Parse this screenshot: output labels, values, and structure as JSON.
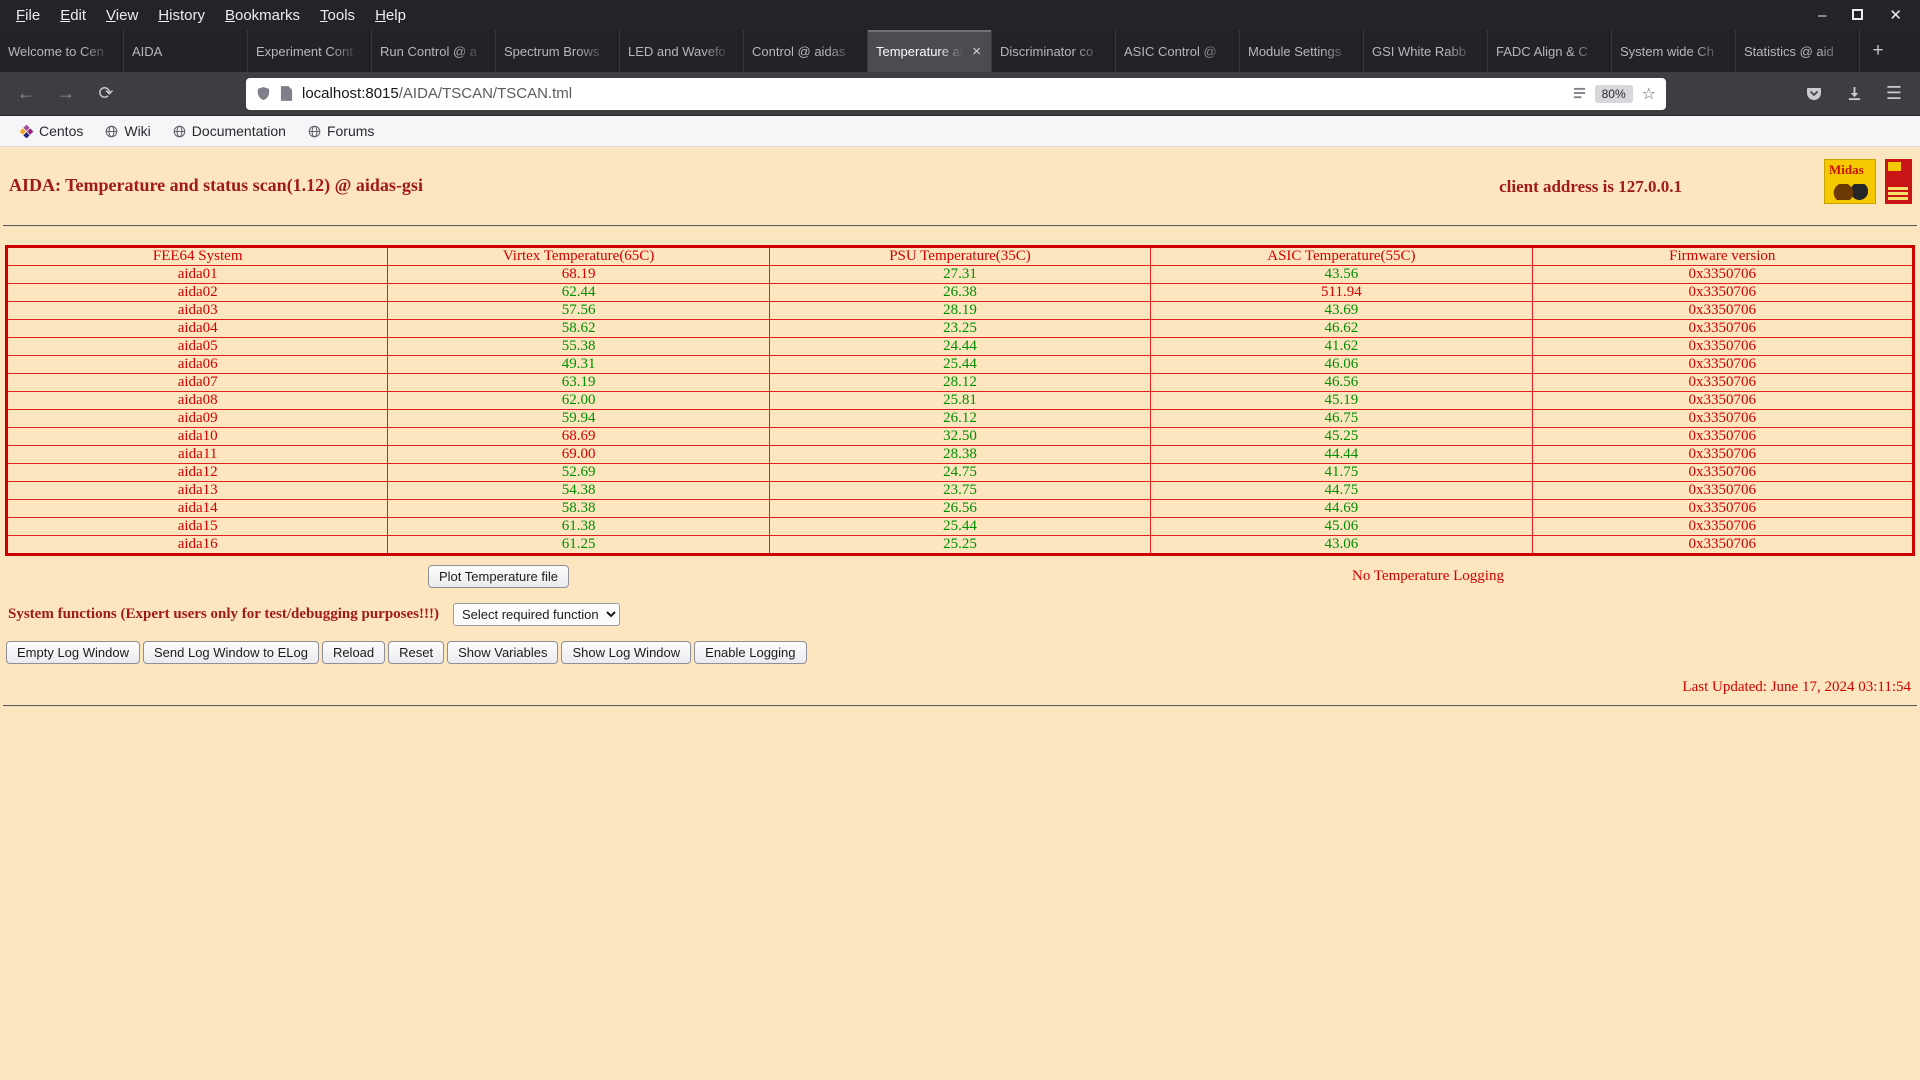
{
  "colors": {
    "page_background": "#fce6c0",
    "title_maroon": "#a01a1a",
    "alert_red": "#d40000",
    "value_green": "#008f00",
    "table_border_red": "#cc0000"
  },
  "window": {
    "menu_items": [
      "File",
      "Edit",
      "View",
      "History",
      "Bookmarks",
      "Tools",
      "Help"
    ],
    "controls": {
      "minimize": "–",
      "close": "✕"
    }
  },
  "tabs": [
    {
      "label": "Welcome to Cen"
    },
    {
      "label": "AIDA"
    },
    {
      "label": "Experiment Cont"
    },
    {
      "label": "Run Control @ a"
    },
    {
      "label": "Spectrum Brows"
    },
    {
      "label": "LED and Wavefo"
    },
    {
      "label": "Control @ aidas"
    },
    {
      "label": "Temperature an",
      "active": true
    },
    {
      "label": "Discriminator co"
    },
    {
      "label": "ASIC Control @"
    },
    {
      "label": "Module Settings"
    },
    {
      "label": "GSI White Rabb"
    },
    {
      "label": "FADC Align & C"
    },
    {
      "label": "System wide Ch"
    },
    {
      "label": "Statistics @ aid"
    }
  ],
  "icons": {
    "new_tab": "+",
    "close_tab": "×",
    "back": "←",
    "forward": "→",
    "reload": "⟳",
    "star": "☆",
    "menu": "☰"
  },
  "navbar": {
    "url_host": "localhost:8015",
    "url_path": "/AIDA/TSCAN/TSCAN.tml",
    "zoom_badge": "80%"
  },
  "bookmarks": [
    "Centos",
    "Wiki",
    "Documentation",
    "Forums"
  ],
  "page": {
    "title": "AIDA: Temperature and status scan(1.12) @ aidas-gsi",
    "client_address": "client address is 127.0.0.1",
    "logo_text": "Midas",
    "table": {
      "headers": [
        "FEE64 System",
        "Virtex Temperature(65C)",
        "PSU Temperature(35C)",
        "ASIC Temperature(55C)",
        "Firmware version"
      ],
      "thresholds": {
        "virtex": 65,
        "psu": 35,
        "asic": 55
      },
      "rows": [
        {
          "name": "aida01",
          "virtex": "68.19",
          "psu": "27.31",
          "asic": "43.56",
          "firmware": "0x3350706"
        },
        {
          "name": "aida02",
          "virtex": "62.44",
          "psu": "26.38",
          "asic": "511.94",
          "firmware": "0x3350706"
        },
        {
          "name": "aida03",
          "virtex": "57.56",
          "psu": "28.19",
          "asic": "43.69",
          "firmware": "0x3350706"
        },
        {
          "name": "aida04",
          "virtex": "58.62",
          "psu": "23.25",
          "asic": "46.62",
          "firmware": "0x3350706"
        },
        {
          "name": "aida05",
          "virtex": "55.38",
          "psu": "24.44",
          "asic": "41.62",
          "firmware": "0x3350706"
        },
        {
          "name": "aida06",
          "virtex": "49.31",
          "psu": "25.44",
          "asic": "46.06",
          "firmware": "0x3350706"
        },
        {
          "name": "aida07",
          "virtex": "63.19",
          "psu": "28.12",
          "asic": "46.56",
          "firmware": "0x3350706"
        },
        {
          "name": "aida08",
          "virtex": "62.00",
          "psu": "25.81",
          "asic": "45.19",
          "firmware": "0x3350706"
        },
        {
          "name": "aida09",
          "virtex": "59.94",
          "psu": "26.12",
          "asic": "46.75",
          "firmware": "0x3350706"
        },
        {
          "name": "aida10",
          "virtex": "68.69",
          "psu": "32.50",
          "asic": "45.25",
          "firmware": "0x3350706"
        },
        {
          "name": "aida11",
          "virtex": "69.00",
          "psu": "28.38",
          "asic": "44.44",
          "firmware": "0x3350706"
        },
        {
          "name": "aida12",
          "virtex": "52.69",
          "psu": "24.75",
          "asic": "41.75",
          "firmware": "0x3350706"
        },
        {
          "name": "aida13",
          "virtex": "54.38",
          "psu": "23.75",
          "asic": "44.75",
          "firmware": "0x3350706"
        },
        {
          "name": "aida14",
          "virtex": "58.38",
          "psu": "26.56",
          "asic": "44.69",
          "firmware": "0x3350706"
        },
        {
          "name": "aida15",
          "virtex": "61.38",
          "psu": "25.44",
          "asic": "45.06",
          "firmware": "0x3350706"
        },
        {
          "name": "aida16",
          "virtex": "61.25",
          "psu": "25.25",
          "asic": "43.06",
          "firmware": "0x3350706"
        }
      ]
    },
    "plot_button": "Plot Temperature file",
    "logging_status": "No Temperature Logging",
    "system_functions_label": "System functions (Expert users only for test/debugging purposes!!!)",
    "function_select_value": "Select required function",
    "action_buttons": [
      "Empty Log Window",
      "Send Log Window to ELog",
      "Reload",
      "Reset",
      "Show Variables",
      "Show Log Window",
      "Enable Logging"
    ],
    "last_updated": "Last Updated: June 17, 2024 03:11:54"
  }
}
